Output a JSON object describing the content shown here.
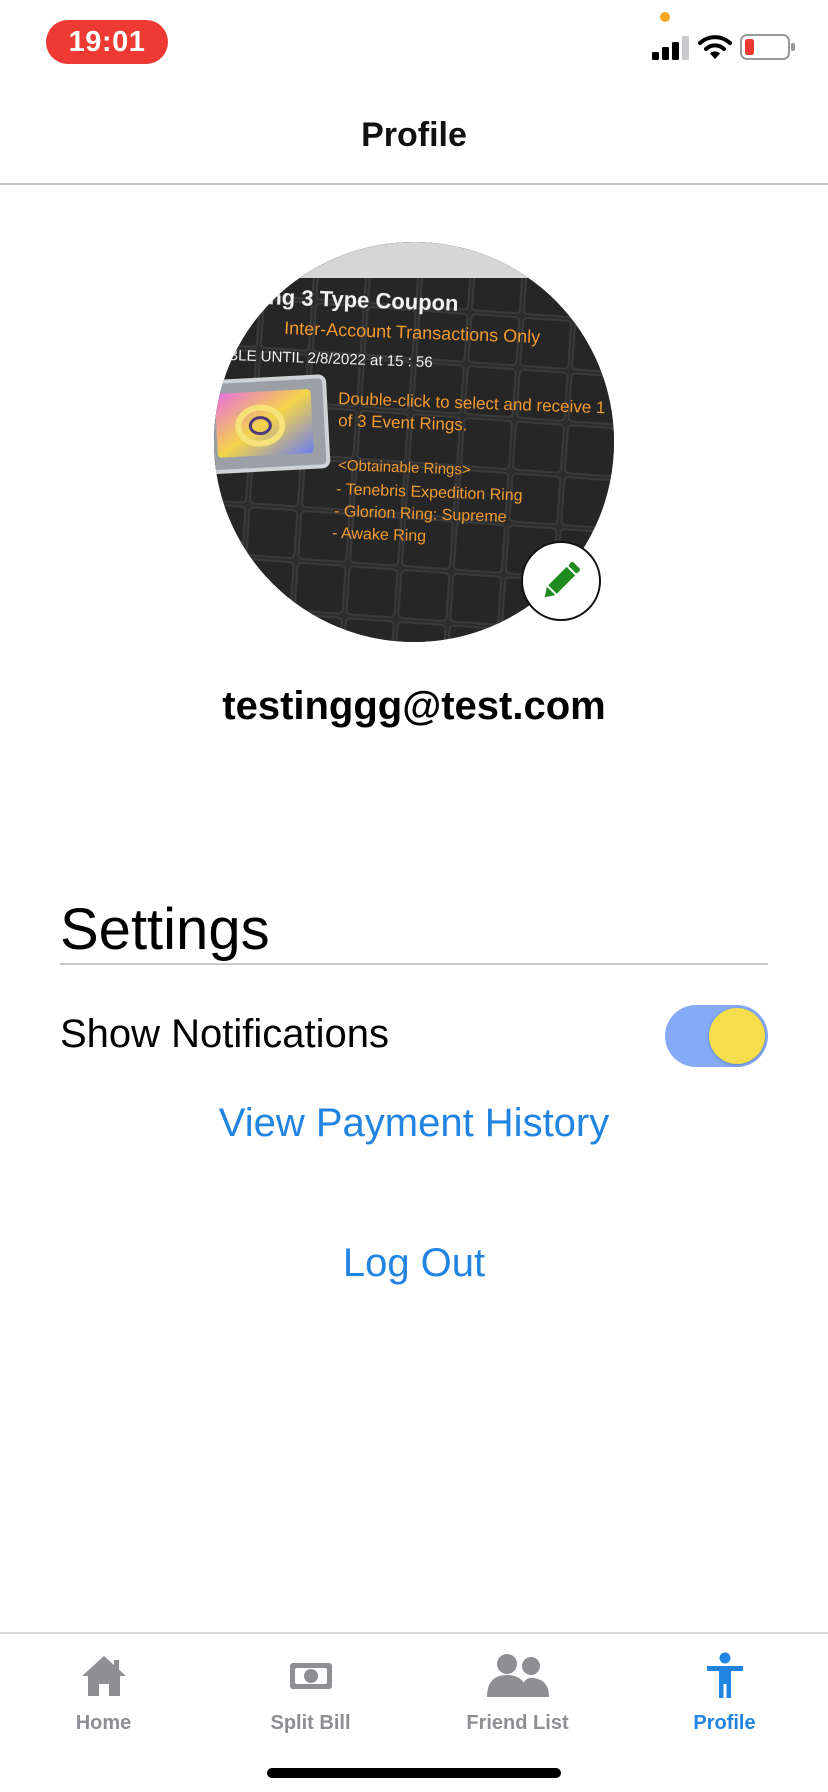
{
  "status_bar": {
    "time": "19:01"
  },
  "nav": {
    "title": "Profile"
  },
  "profile": {
    "email": "testinggg@test.com",
    "avatar_image_text": [
      "ing 3 Type Coupon",
      "Inter-Account Transactions Only",
      "BLE UNTIL 2/8/2022 at 15 : 56",
      "Double-click to select and receive 1",
      "of 3 Event Rings.",
      "<Obtainable Rings>",
      "- Tenebris Expedition Ring",
      "- Glorion Ring: Supreme",
      "- Awake Ring"
    ]
  },
  "settings": {
    "title": "Settings",
    "show_notifications_label": "Show Notifications",
    "show_notifications_on": true,
    "view_payment_history_label": "View Payment History",
    "log_out_label": "Log Out"
  },
  "tab_bar": {
    "items": [
      {
        "label": "Home",
        "icon": "home-icon",
        "active": false
      },
      {
        "label": "Split Bill",
        "icon": "money-icon",
        "active": false
      },
      {
        "label": "Friend List",
        "icon": "users-icon",
        "active": false
      },
      {
        "label": "Profile",
        "icon": "person-icon",
        "active": true
      }
    ]
  },
  "colors": {
    "accent": "#2184e0",
    "time_pill": "#ee3a33",
    "toggle_track": "#84aaf8",
    "toggle_knob": "#f5dd4b",
    "edit_icon": "#1f8a1f",
    "tab_inactive": "#8e8e93"
  }
}
